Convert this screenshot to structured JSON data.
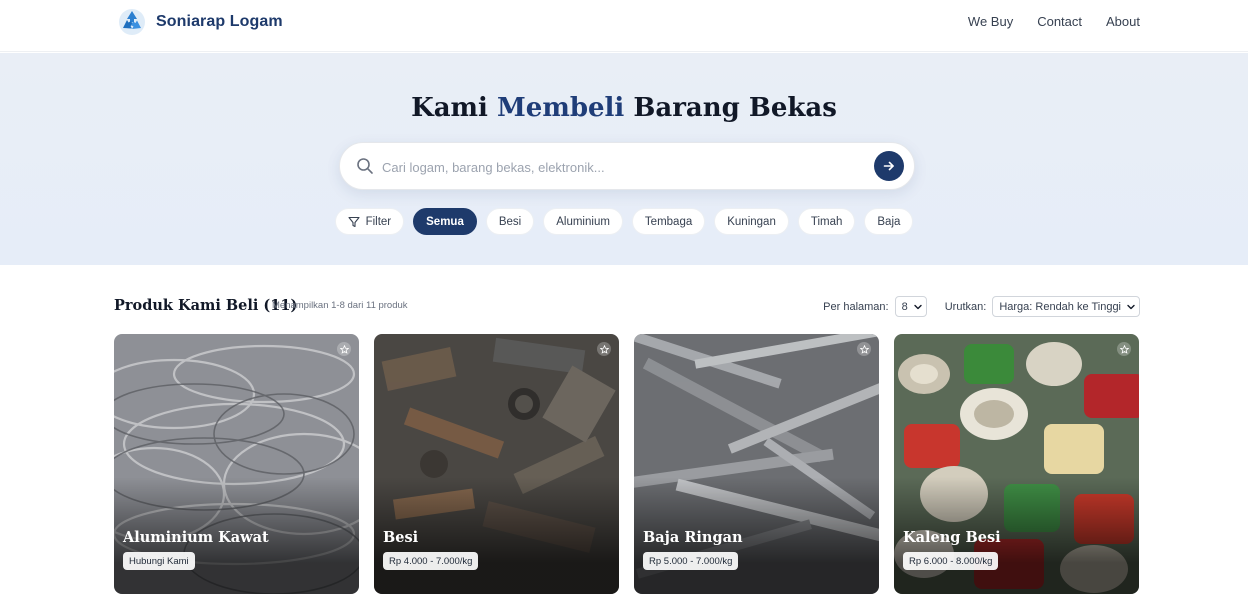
{
  "brand": {
    "name": "Soniarap Logam",
    "icon": "recycle-icon",
    "color": "#1e3a6b"
  },
  "nav": [
    {
      "label": "We Buy"
    },
    {
      "label": "Contact"
    },
    {
      "label": "About"
    }
  ],
  "hero": {
    "title_pre": "Kami",
    "title_accent": "Membeli",
    "title_post": "Barang Bekas",
    "search_placeholder": "Cari logam, barang bekas, elektronik...",
    "search_icon": "search-icon",
    "submit_icon": "arrow-right-icon"
  },
  "filters": {
    "filter_label": "Filter",
    "filter_icon": "funnel-icon",
    "chips": [
      {
        "label": "Semua",
        "active": true
      },
      {
        "label": "Besi",
        "active": false
      },
      {
        "label": "Aluminium",
        "active": false
      },
      {
        "label": "Tembaga",
        "active": false
      },
      {
        "label": "Kuningan",
        "active": false
      },
      {
        "label": "Timah",
        "active": false
      },
      {
        "label": "Baja",
        "active": false
      }
    ]
  },
  "products": {
    "title": "Produk Kami Beli (11)",
    "subtitle": "Menampilkan 1-8 dari 11 produk",
    "per_page_label": "Per halaman:",
    "per_page_value": "8",
    "sort_label": "Urutkan:",
    "sort_value": "Harga: Rendah ke Tinggi",
    "items": [
      {
        "name": "Aluminium Kawat",
        "price": "Hubungi Kami"
      },
      {
        "name": "Besi",
        "price": "Rp 4.000 - 7.000/kg"
      },
      {
        "name": "Baja Ringan",
        "price": "Rp 5.000 - 7.000/kg"
      },
      {
        "name": "Kaleng Besi",
        "price": "Rp 6.000 - 8.000/kg"
      }
    ]
  },
  "colors": {
    "accent": "#1e3a6b",
    "hero_bg": "#e9eef6"
  }
}
